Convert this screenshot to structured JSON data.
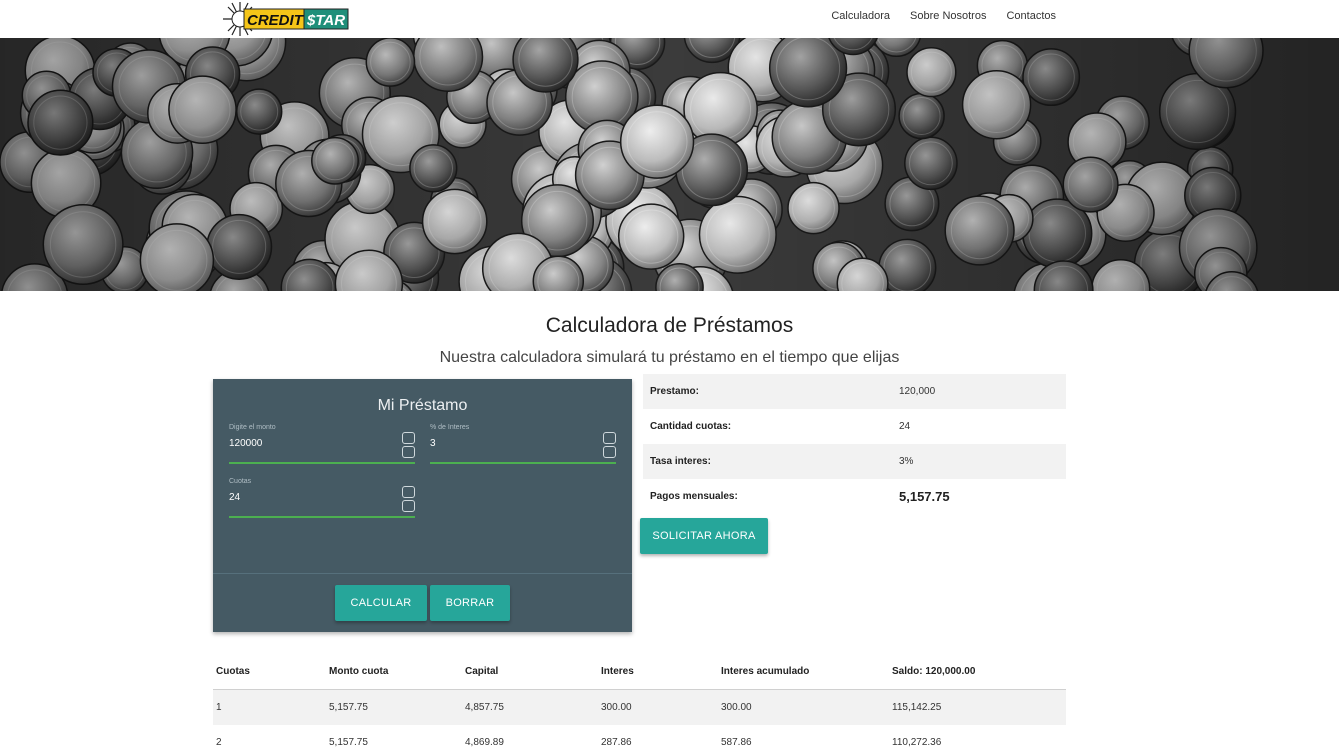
{
  "brand": {
    "logo_word1": "CREDIT",
    "logo_word2": "STAR"
  },
  "nav": {
    "items": [
      "Calculadora",
      "Sobre Nosotros",
      "Contactos"
    ]
  },
  "page": {
    "title": "Calculadora de Préstamos",
    "subtitle": "Nuestra calculadora simulará tu préstamo en el tiempo que elijas"
  },
  "loan_form": {
    "title": "Mi Préstamo",
    "amount": {
      "label": "Digite el monto",
      "value": "120000"
    },
    "interest": {
      "label": "% de Interes",
      "value": "3"
    },
    "installments": {
      "label": "Cuotas",
      "value": "24"
    },
    "calc_label": "Calcular",
    "clear_label": "Borrar"
  },
  "summary": {
    "rows": [
      {
        "label": "Prestamo:",
        "value": "120,000"
      },
      {
        "label": "Cantidad cuotas:",
        "value": "24"
      },
      {
        "label": "Tasa interes:",
        "value": "3%"
      },
      {
        "label": "Pagos mensuales:",
        "value": "5,157.75"
      }
    ],
    "apply_label": "Solicitar ahora"
  },
  "amortization": {
    "headers": [
      "Cuotas",
      "Monto cuota",
      "Capital",
      "Interes",
      "Interes acumulado",
      "Saldo: 120,000.00"
    ],
    "rows": [
      [
        "1",
        "5,157.75",
        "4,857.75",
        "300.00",
        "300.00",
        "115,142.25"
      ],
      [
        "2",
        "5,157.75",
        "4,869.89",
        "287.86",
        "587.86",
        "110,272.36"
      ]
    ]
  },
  "colors": {
    "card_bg": "#455a64",
    "accent_button": "#26a69a",
    "input_underline": "#4caf50",
    "logo_yellow": "#f5c518",
    "logo_teal": "#1f8f7a"
  }
}
